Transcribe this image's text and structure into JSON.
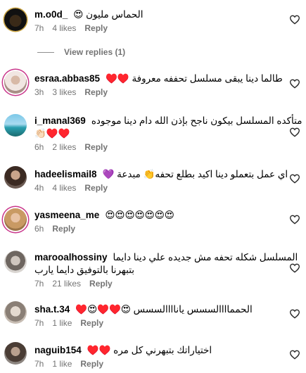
{
  "comments": [
    {
      "username": "m.o0d_",
      "text": "الحماس مليون 😍",
      "time": "7h",
      "likes": "4 likes",
      "reply": "Reply",
      "emoji": ""
    },
    {
      "username": "esraa.abbas85",
      "text": "طالما دينا يبقى مسلسل تحففه معروفة ♥️♥️",
      "time": "3h",
      "likes": "3 likes",
      "reply": "Reply",
      "emoji": ""
    },
    {
      "username": "i_manal369",
      "text": "متأكده المسلسل بيكون ناجح بإذن الله دام دينا موجوده",
      "line2": "♥️♥️👏🏻",
      "time": "6h",
      "likes": "2 likes",
      "reply": "Reply"
    },
    {
      "username": "hadeelismail8",
      "text": "اي عمل بتعملو دينا اكيد بطلع تحفه👏 مبدعة 💜",
      "time": "4h",
      "likes": "4 likes",
      "reply": "Reply"
    },
    {
      "username": "yasmeena_me",
      "text": "😍😍😍😍😍😍😍",
      "time": "6h",
      "likes": "",
      "reply": "Reply"
    },
    {
      "username": "marooalhossiny",
      "text": "المسلسل شكله تحفه مش جديده علي دينا دايما",
      "line2": "بتبهرنا بالتوفيق دايما يارب",
      "time": "7h",
      "likes": "21 likes",
      "reply": "Reply"
    },
    {
      "username": "sha.t.34",
      "text": "الحمماااالسسس ياناااالسسس 😍♥️♥️😍♥️",
      "time": "7h",
      "likes": "1 like",
      "reply": "Reply"
    },
    {
      "username": "naguib154",
      "text": "اختياراتك بتبهرني كل مره ♥️♥️",
      "time": "7h",
      "likes": "1 like",
      "reply": "Reply"
    }
  ],
  "view_replies": "View replies (1)",
  "colors": {
    "meta": "#737373",
    "ring": "#c9368b"
  }
}
